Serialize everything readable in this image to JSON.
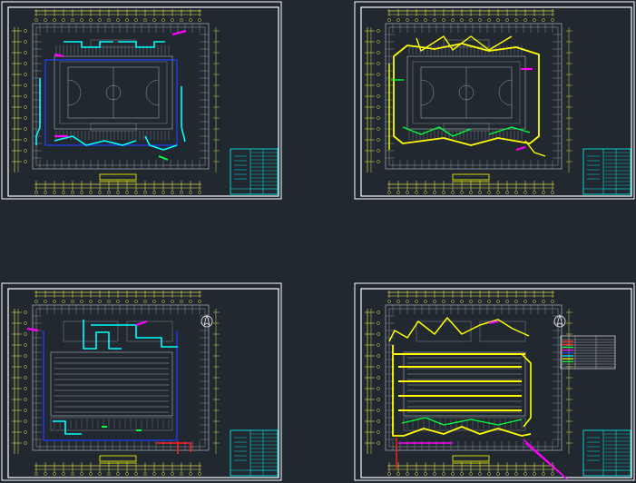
{
  "colors": {
    "background": "#212830",
    "sheet_frame": "#ffffff",
    "title_block": "#00e5e5",
    "architecture": "#9aa2aa",
    "dimension": "#d8d84a",
    "pipe_cyan": "#00ffff",
    "pipe_blue": "#1f3fff",
    "pipe_yellow": "#ffff00",
    "pipe_green": "#00ff3a",
    "pipe_magenta": "#ff00ff",
    "pipe_red": "#ff2020",
    "caption": "#ffff00"
  },
  "sheets": [
    {
      "id": "sheet-1",
      "kind": "sports-hall",
      "pipe_scheme": "cyan-blue",
      "has_north_arrow": false,
      "has_legend": false
    },
    {
      "id": "sheet-2",
      "kind": "sports-hall",
      "pipe_scheme": "yellow-green",
      "has_north_arrow": false,
      "has_legend": false
    },
    {
      "id": "sheet-3",
      "kind": "natatorium",
      "pipe_scheme": "cyan-blue",
      "has_north_arrow": true,
      "has_legend": false
    },
    {
      "id": "sheet-4",
      "kind": "natatorium",
      "pipe_scheme": "yellow-green",
      "has_north_arrow": true,
      "has_legend": true
    }
  ]
}
